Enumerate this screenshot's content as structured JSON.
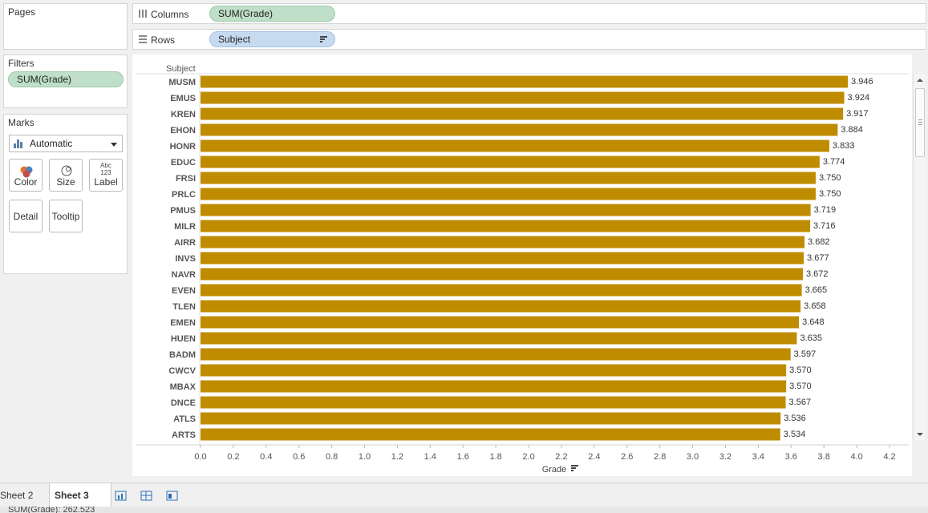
{
  "cards": {
    "pages_title": "Pages",
    "filters_title": "Filters",
    "marks_title": "Marks"
  },
  "filters": {
    "pill": "SUM(Grade)"
  },
  "marks": {
    "type": "Automatic",
    "buttons": {
      "color": "Color",
      "size": "Size",
      "label": "Label",
      "label_icon_top": "Abc",
      "label_icon_bottom": "123",
      "detail": "Detail",
      "tooltip": "Tooltip"
    }
  },
  "shelves": {
    "columns_label": "Columns",
    "columns_pill": "SUM(Grade)",
    "rows_label": "Rows",
    "rows_pill": "Subject"
  },
  "tabs": {
    "sheet2": "Sheet 2",
    "sheet3": "Sheet 3"
  },
  "status": {
    "text": "SUM(Grade): 262.523"
  },
  "colors": {
    "bar": "#bf8c00",
    "accent_green": "#bfdfc8",
    "accent_blue": "#c7dbf0"
  },
  "icons": {
    "columns": "columns-shelf-icon",
    "rows": "rows-shelf-icon",
    "sort": "sort-descending-icon",
    "new_worksheet": "new-worksheet-icon",
    "new_dashboard": "new-dashboard-icon",
    "new_story": "new-story-icon"
  },
  "chart_data": {
    "type": "bar",
    "orientation": "horizontal",
    "row_header": "Subject",
    "xlabel": "Grade",
    "xlim": [
      0,
      4.2
    ],
    "xticks": [
      "0.0",
      "0.2",
      "0.4",
      "0.6",
      "0.8",
      "1.0",
      "1.2",
      "1.4",
      "1.6",
      "1.8",
      "2.0",
      "2.2",
      "2.4",
      "2.6",
      "2.8",
      "3.0",
      "3.2",
      "3.4",
      "3.6",
      "3.8",
      "4.0",
      "4.2"
    ],
    "categories": [
      "MUSM",
      "EMUS",
      "KREN",
      "EHON",
      "HONR",
      "EDUC",
      "FRSI",
      "PRLC",
      "PMUS",
      "MILR",
      "AIRR",
      "INVS",
      "NAVR",
      "EVEN",
      "TLEN",
      "EMEN",
      "HUEN",
      "BADM",
      "CWCV",
      "MBAX",
      "DNCE",
      "ATLS",
      "ARTS"
    ],
    "values": [
      3.946,
      3.924,
      3.917,
      3.884,
      3.833,
      3.774,
      3.75,
      3.75,
      3.719,
      3.716,
      3.682,
      3.677,
      3.672,
      3.665,
      3.658,
      3.648,
      3.635,
      3.597,
      3.57,
      3.57,
      3.567,
      3.536,
      3.534
    ],
    "labels": [
      "3.946",
      "3.924",
      "3.917",
      "3.884",
      "3.833",
      "3.774",
      "3.750",
      "3.750",
      "3.719",
      "3.716",
      "3.682",
      "3.677",
      "3.672",
      "3.665",
      "3.658",
      "3.648",
      "3.635",
      "3.597",
      "3.570",
      "3.570",
      "3.567",
      "3.536",
      "3.534"
    ],
    "grid": false,
    "data_labels": true
  }
}
